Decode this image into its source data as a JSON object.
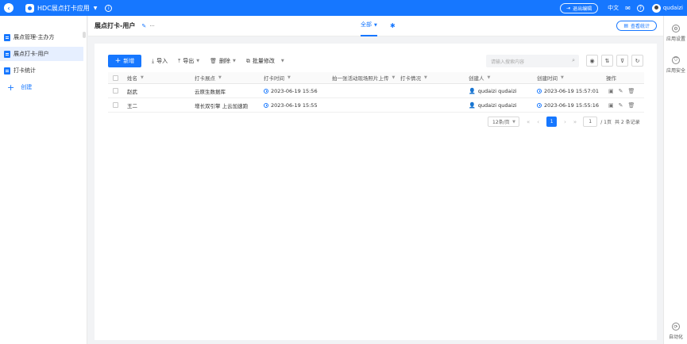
{
  "topbar": {
    "app_title": "HDC展点打卡应用",
    "exit_edit_label": "退出编辑",
    "language_label": "中文",
    "username": "qudaizi"
  },
  "sidebar": {
    "items": [
      {
        "label": "展点管理-主办方"
      },
      {
        "label": "展点打卡-用户"
      },
      {
        "label": "打卡统计"
      }
    ],
    "create_label": "创建"
  },
  "header": {
    "title": "展点打卡-用户",
    "more": "···",
    "tab_label": "全部",
    "stats_label": "查看统计"
  },
  "toolbar": {
    "new_label": "新增",
    "import_label": "导入",
    "export_label": "导出",
    "delete_label": "删除",
    "batch_edit_label": "批量修改",
    "search_placeholder": "请输入搜索内容"
  },
  "table": {
    "columns": [
      "姓名",
      "打卡展点",
      "打卡时间",
      "拍一张活动现场照片上传",
      "打卡情况",
      "创建人",
      "创建时间",
      "操作"
    ],
    "rows": [
      {
        "name": "赵武",
        "spot": "云原生数据库",
        "checkin_time": "2023-06-19 15:56",
        "photo": "",
        "status": "",
        "creator": "qudaizi qudaizi",
        "created": "2023-06-19 15:57:01"
      },
      {
        "name": "王二",
        "spot": "增长双引擎 上云加速跑",
        "checkin_time": "2023-06-19 15:55",
        "photo": "",
        "status": "",
        "creator": "qudaizi qudaizi",
        "created": "2023-06-19 15:55:16"
      }
    ]
  },
  "pagination": {
    "page_size": "12条/页",
    "current_page": "1",
    "jump_value": "1",
    "page_count_text": "/ 1页",
    "total_text": "共 2 条记录"
  },
  "rightbar": {
    "items": [
      {
        "label": "应用设置"
      },
      {
        "label": "应用安全"
      }
    ],
    "automation_label": "自动化"
  },
  "colors": {
    "accent": "#1677ff"
  }
}
